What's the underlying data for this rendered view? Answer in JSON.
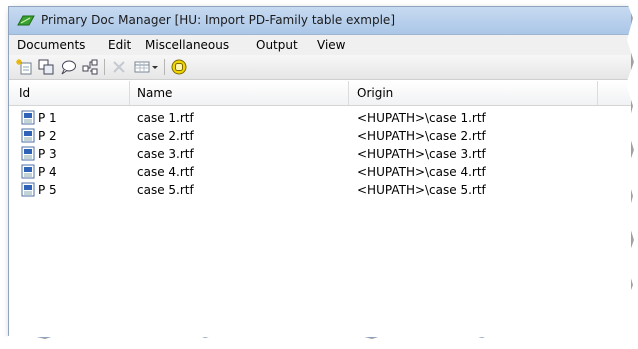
{
  "window": {
    "title": "Primary Doc Manager [HU: Import PD-Family table exmple]"
  },
  "menu": {
    "items": [
      "Documents",
      "Edit",
      "Miscellaneous",
      "Output",
      "View"
    ]
  },
  "toolbar": {
    "icons": [
      "new-document-icon",
      "copy-icon",
      "comment-icon",
      "tree-icon",
      "delete-icon",
      "table-view-icon",
      "dropdown-arrow-icon",
      "highlight-ring-icon"
    ]
  },
  "table": {
    "columns": [
      "Id",
      "Name",
      "Origin"
    ],
    "rows": [
      {
        "id": "P 1",
        "name": "case 1.rtf",
        "origin": "<HUPATH>\\case 1.rtf"
      },
      {
        "id": "P 2",
        "name": "case 2.rtf",
        "origin": "<HUPATH>\\case 2.rtf"
      },
      {
        "id": "P 3",
        "name": "case 3.rtf",
        "origin": "<HUPATH>\\case 3.rtf"
      },
      {
        "id": "P 4",
        "name": "case 4.rtf",
        "origin": "<HUPATH>\\case 4.rtf"
      },
      {
        "id": "P 5",
        "name": "case 5.rtf",
        "origin": "<HUPATH>\\case 5.rtf"
      }
    ]
  },
  "colors": {
    "titlebar": "#aac6e8",
    "accent_yellow": "#f2d400"
  }
}
